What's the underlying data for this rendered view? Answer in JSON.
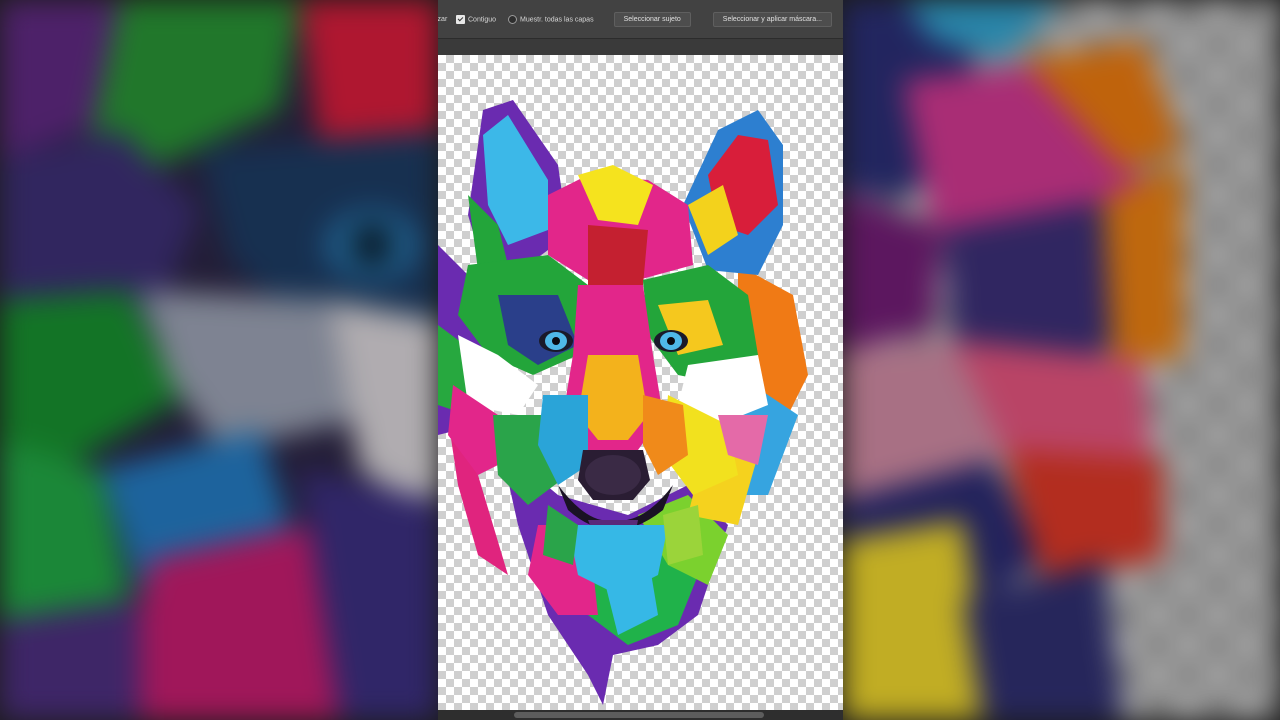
{
  "options_bar": {
    "truncated_label": "izar",
    "contiguous_label": "Contiguo",
    "contiguous_checked": true,
    "sample_all_label": "Muestr. todas las capas",
    "sample_all_checked": false,
    "select_subject_label": "Seleccionar sujeto",
    "select_and_mask_label": "Seleccionar y aplicar máscara..."
  },
  "canvas": {
    "background": "transparent-checkerboard",
    "subject": "wolf-head-illustration"
  },
  "colors": {
    "ui_panel": "#424242",
    "workspace": "#3a3a3a"
  }
}
